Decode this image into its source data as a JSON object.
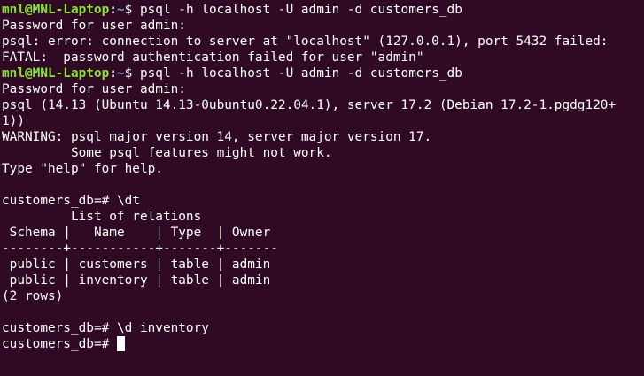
{
  "prompt": {
    "user_host": "mnl@MNL-Laptop",
    "separator": ":",
    "path": "~",
    "symbol": "$ "
  },
  "commands": {
    "c1": "psql -h localhost -U admin -d customers_db",
    "c2": "psql -h localhost -U admin -d customers_db"
  },
  "output": {
    "l2": "Password for user admin:",
    "l3": "psql: error: connection to server at \"localhost\" (127.0.0.1), port 5432 failed:",
    "l4": "FATAL:  password authentication failed for user \"admin\"",
    "l6": "Password for user admin:",
    "l7": "psql (14.13 (Ubuntu 14.13-0ubuntu0.22.04.1), server 17.2 (Debian 17.2-1.pgdg120+",
    "l8": "1))",
    "l9": "WARNING: psql major version 14, server major version 17.",
    "l10": "         Some psql features might not work.",
    "l11": "Type \"help\" for help.",
    "l12": "",
    "l13": "customers_db=# \\dt",
    "l14": "         List of relations",
    "l15": " Schema |   Name    | Type  | Owner ",
    "l16": "--------+-----------+-------+-------",
    "l17": " public | customers | table | admin",
    "l18": " public | inventory | table | admin",
    "l19": "(2 rows)",
    "l20": "",
    "l21": "customers_db=# \\d inventory",
    "l22": "customers_db=# "
  }
}
